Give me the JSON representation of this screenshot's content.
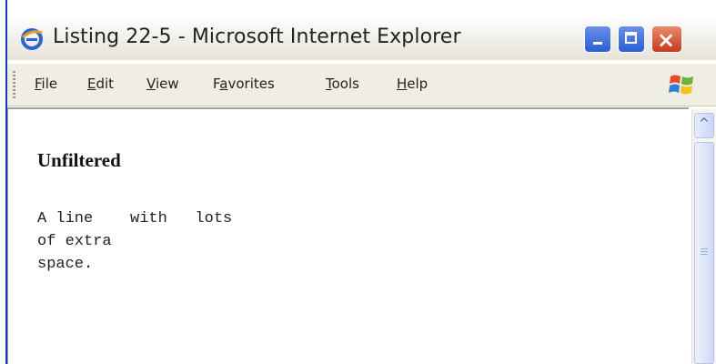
{
  "window": {
    "title": "Listing 22-5 - Microsoft Internet Explorer",
    "icon": "ie-icon"
  },
  "caption_buttons": {
    "minimize": "minimize-icon",
    "maximize": "maximize-icon",
    "close": "×"
  },
  "menubar": {
    "items": [
      {
        "accel": "F",
        "rest": "ile"
      },
      {
        "accel": "E",
        "rest": "dit"
      },
      {
        "accel": "V",
        "rest": "iew"
      },
      {
        "pre": "F",
        "accel": "a",
        "rest": "vorites"
      },
      {
        "accel": "T",
        "rest": "ools"
      },
      {
        "accel": "H",
        "rest": "elp"
      }
    ],
    "logo": "windows-flag-icon"
  },
  "page": {
    "heading": "Unfiltered",
    "preformatted": "A line    with   lots\nof extra\nspace."
  },
  "scrollbar": {
    "up_arrow": "^"
  },
  "colors": {
    "title_text": "#222222",
    "frame_blue": "#0a3fb6",
    "menubar_bg": "#efede4"
  }
}
